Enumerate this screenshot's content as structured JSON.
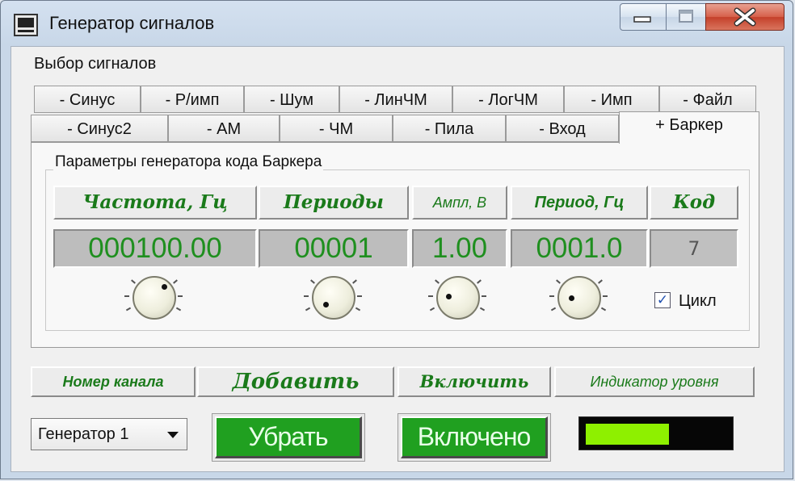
{
  "window": {
    "title": "Генератор сигналов"
  },
  "signal_select_label": "Выбор сигналов",
  "tabs_row1": [
    "- Синус",
    "- Р/имп",
    "- Шум",
    "- ЛинЧМ",
    "- ЛогЧМ",
    "- Имп",
    "- Файл"
  ],
  "tabs_row2": [
    "- Синус2",
    "- АМ",
    "- ЧМ",
    "- Пила",
    "- Вход",
    "+ Баркер"
  ],
  "active_tab": "+ Баркер",
  "panel": {
    "group_title": "Параметры генератора кода Баркера",
    "headers": {
      "frequency": "Частота, Гц",
      "periods": "Периоды",
      "amplitude": "Ампл, В",
      "period_hz": "Период, Гц",
      "code": "Код"
    },
    "displays": {
      "frequency": "000100.00",
      "periods": "00001",
      "amplitude": "1.00",
      "period_hz": "0001.0",
      "code": "7"
    },
    "cycle_label": "Цикл",
    "cycle_checked": true
  },
  "bottom_headers": {
    "channel": "Номер канала",
    "add": "Добавить",
    "enable": "Включить",
    "level": "Индикатор уровня"
  },
  "channel_select": {
    "value": "Генератор 1"
  },
  "buttons": {
    "remove": "Убрать",
    "enabled": "Включено"
  },
  "level_indicator": {
    "fill_fraction": 0.5,
    "color": "#8ef000"
  },
  "colors": {
    "accent_green": "#20a020",
    "label_green": "#1a7a1a"
  }
}
